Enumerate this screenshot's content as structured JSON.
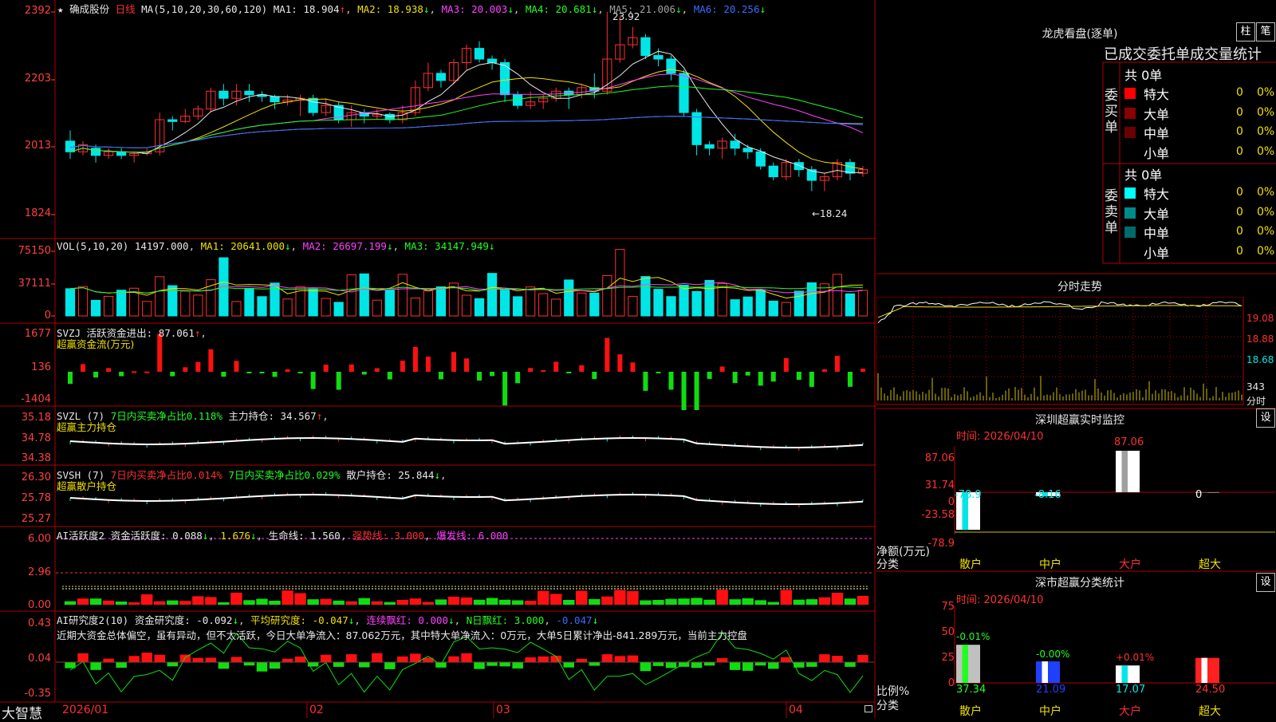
{
  "header": {
    "star": "★",
    "stock_name": "确成股份",
    "period": "日线",
    "ma_label": "MA(5,10,20,30,60,120)",
    "ma_values": [
      {
        "label": "MA1: 18.904",
        "arrow": "↑",
        "color": "#e8e8e8"
      },
      {
        "label": "MA2: 18.938",
        "arrow": "↓",
        "color": "#f0e000"
      },
      {
        "label": "MA3: 20.003",
        "arrow": "↓",
        "color": "#ff40ff"
      },
      {
        "label": "MA4: 20.681",
        "arrow": "↓",
        "color": "#20ff20"
      },
      {
        "label": "MA5: 21.006",
        "arrow": "↓",
        "color": "#a0a0a0"
      },
      {
        "label": "MA6: 20.256",
        "arrow": "↓",
        "color": "#3a6cff"
      }
    ]
  },
  "price_axis": [
    "2392",
    "2203",
    "2013",
    "1824"
  ],
  "price_marks": {
    "high": "23.92",
    "low": "←18.24"
  },
  "vol": {
    "title": "VOL(5,10,20)",
    "value": "14197.000",
    "ma1": "MA1: 20641.000",
    "ma2": "MA2: 26697.199",
    "ma3": "MA3: 34147.949",
    "arrow": "↓",
    "axis": [
      "75150",
      "37111",
      "0"
    ]
  },
  "svzj": {
    "title": "SVZJ",
    "label": "活跃资金进出: 87.061",
    "arrow": "↑",
    "sub": "超赢资金流(万元)",
    "axis": [
      "1677",
      "136",
      "-1404"
    ]
  },
  "svzl": {
    "title": "SVZL (7)",
    "label1": "7日内买卖净占比0.118%",
    "label2": "主力持仓: 34.567",
    "arrow": "↑",
    "sub": "超赢主力持仓",
    "axis": [
      "35.18",
      "34.78",
      "34.38"
    ]
  },
  "svsh": {
    "title": "SVSH (7)",
    "label1": "7日内买卖净占比0.014%",
    "label2": "7日内买卖净占比0.029%",
    "label3": "散户持仓: 25.844",
    "arrow": "↓",
    "sub": "超赢散户持仓",
    "axis": [
      "26.30",
      "25.78",
      "25.27"
    ]
  },
  "ai_active": {
    "title": "AI活跃度2",
    "label": "资金活跃度: 0.088",
    "v2": "1.676",
    "life": "生命线: 1.560",
    "strong": "强势线: 3.000",
    "burst": "爆发线: 6.000",
    "axis": [
      "6.00",
      "2.96",
      "0.00"
    ]
  },
  "ai_research": {
    "title": "AI研究度2(10)",
    "label": "资金研究度: -0.092",
    "avg": "平均研究度: -0.047",
    "cont": "连续飘红: 0.000",
    "nday": "N日飘红: 3.000",
    "nval": "-0.047",
    "comment": "近期大资金总体偏空，虽有异动，但不太活跃，今日大单净流入：87.062万元，其中特大单净流入：0万元，大单5日累计净出-841.289万元，当前主力控盘",
    "axis": [
      "0.43",
      "0.04",
      "-0.35"
    ]
  },
  "bottom": {
    "brand": "大智慧",
    "dates": [
      "2026/01",
      "02",
      "03",
      "04"
    ]
  },
  "right": {
    "dragon_title": "龙虎看盘(逐单)",
    "btn_zhu": "柱",
    "btn_bi": "笔",
    "table_header": "已成交委托单成交量统计",
    "buy_label": "委买单",
    "sell_label": "委卖单",
    "buy_total": "共 0单",
    "sell_total": "共 0单",
    "buy_rows": [
      {
        "name": "特大",
        "count": "0",
        "pct": "0%",
        "color": "#ff0000"
      },
      {
        "name": "大单",
        "count": "0",
        "pct": "0%",
        "color": "#8b0000"
      },
      {
        "name": "中单",
        "count": "0",
        "pct": "0%",
        "color": "#6b0000"
      },
      {
        "name": "小单",
        "count": "0",
        "pct": "0%",
        "color": ""
      }
    ],
    "sell_rows": [
      {
        "name": "特大",
        "count": "0",
        "pct": "0%",
        "color": "#00ffff"
      },
      {
        "name": "大单",
        "count": "0",
        "pct": "0%",
        "color": "#008b8b"
      },
      {
        "name": "中单",
        "count": "0",
        "pct": "0%",
        "color": "#006b6b"
      },
      {
        "name": "小单",
        "count": "0",
        "pct": "0%",
        "color": ""
      }
    ],
    "intraday_title": "分时走势",
    "intraday_axis": [
      "19.08",
      "18.88",
      "18.68",
      "343",
      "分时"
    ],
    "sz_monitor": {
      "title": "深圳超赢实时监控",
      "btn": "设",
      "time": "时间: 2026/04/10",
      "axis": [
        "87.06",
        "31.74",
        "0",
        "-23.58",
        "-78.9"
      ],
      "ylabel": "净额(万元)",
      "xlabel": "分类",
      "categories": [
        "散户",
        "中户",
        "大户",
        "超大"
      ],
      "values": [
        "-78.9",
        "-8.16",
        "87.06",
        "0"
      ]
    },
    "sz_class": {
      "title": "深市超赢分类统计",
      "btn": "设",
      "time": "时间: 2026/04/10",
      "axis": [
        "75",
        "50",
        "25",
        "0"
      ],
      "ylabel": "比例%",
      "xlabel": "分类",
      "categories": [
        "散户",
        "中户",
        "大户",
        "超大"
      ],
      "values": [
        "37.34",
        "21.09",
        "17.07",
        "24.50"
      ],
      "changes": [
        "-0.01%",
        "-0.00%",
        "+0.01%",
        ""
      ]
    }
  },
  "colors": {
    "up": "#ff3030",
    "down": "#00e6e6",
    "grid": "#b00000",
    "bg": "#000000"
  },
  "chart_data": [
    {
      "type": "candlestick",
      "title": "确成股份 日线",
      "ylim": [
        18.24,
        23.92
      ],
      "x": [
        "2026/01",
        "02",
        "03",
        "04"
      ],
      "candles": [
        [
          20.3,
          20.0,
          20.6,
          19.8
        ],
        [
          20.0,
          20.2,
          20.3,
          19.9
        ],
        [
          20.1,
          19.9,
          20.2,
          19.7
        ],
        [
          19.9,
          20.0,
          20.1,
          19.8
        ],
        [
          20.0,
          19.9,
          20.1,
          19.8
        ],
        [
          19.9,
          19.95,
          20.0,
          19.7
        ],
        [
          19.95,
          20.0,
          20.1,
          19.9
        ],
        [
          20.0,
          20.9,
          21.1,
          19.9
        ],
        [
          20.9,
          20.85,
          21.0,
          20.6
        ],
        [
          20.85,
          21.0,
          21.2,
          20.8
        ],
        [
          21.0,
          21.2,
          21.3,
          20.9
        ],
        [
          21.2,
          21.7,
          21.8,
          21.1
        ],
        [
          21.7,
          21.5,
          21.9,
          21.3
        ],
        [
          21.5,
          21.7,
          21.9,
          21.3
        ],
        [
          21.7,
          21.6,
          21.9,
          21.4
        ],
        [
          21.6,
          21.55,
          21.7,
          21.4
        ],
        [
          21.55,
          21.4,
          21.6,
          21.2
        ],
        [
          21.4,
          21.45,
          21.6,
          21.3
        ],
        [
          21.45,
          21.5,
          21.6,
          21.0
        ],
        [
          21.5,
          21.1,
          21.6,
          21.0
        ],
        [
          21.1,
          21.3,
          21.5,
          21.0
        ],
        [
          21.3,
          20.9,
          21.4,
          20.8
        ],
        [
          20.9,
          21.1,
          21.3,
          20.7
        ],
        [
          21.1,
          21.0,
          21.2,
          20.8
        ],
        [
          21.0,
          21.05,
          21.2,
          20.9
        ],
        [
          21.05,
          20.9,
          21.1,
          20.8
        ],
        [
          20.9,
          21.1,
          21.3,
          20.8
        ],
        [
          21.1,
          21.8,
          22.0,
          21.0
        ],
        [
          21.8,
          22.2,
          22.5,
          21.7
        ],
        [
          22.2,
          22.0,
          22.3,
          21.8
        ],
        [
          22.0,
          22.5,
          22.6,
          21.9
        ],
        [
          22.5,
          22.9,
          23.0,
          22.3
        ],
        [
          22.9,
          22.6,
          23.1,
          22.5
        ],
        [
          22.6,
          22.5,
          22.7,
          22.3
        ],
        [
          22.5,
          21.6,
          22.6,
          21.4
        ],
        [
          21.6,
          21.3,
          21.7,
          21.2
        ],
        [
          21.3,
          21.4,
          21.7,
          21.2
        ],
        [
          21.4,
          21.5,
          21.6,
          21.2
        ],
        [
          21.5,
          21.7,
          21.8,
          21.4
        ],
        [
          21.7,
          21.6,
          21.8,
          21.2
        ],
        [
          21.6,
          21.8,
          21.9,
          21.5
        ],
        [
          21.8,
          21.7,
          22.2,
          21.5
        ],
        [
          21.7,
          22.6,
          23.92,
          21.6
        ],
        [
          22.6,
          23.0,
          23.8,
          22.5
        ],
        [
          23.0,
          23.2,
          23.5,
          22.9
        ],
        [
          23.2,
          22.7,
          23.3,
          22.6
        ],
        [
          22.7,
          22.6,
          22.9,
          22.4
        ],
        [
          22.6,
          22.2,
          22.7,
          22.0
        ],
        [
          22.2,
          21.1,
          22.3,
          21.0
        ],
        [
          21.1,
          20.2,
          21.2,
          19.9
        ],
        [
          20.2,
          20.1,
          20.3,
          19.9
        ],
        [
          20.1,
          20.3,
          20.4,
          19.8
        ],
        [
          20.3,
          20.1,
          20.5,
          19.9
        ],
        [
          20.1,
          20.0,
          20.2,
          19.8
        ],
        [
          20.0,
          19.6,
          20.1,
          19.5
        ],
        [
          19.6,
          19.3,
          19.7,
          19.2
        ],
        [
          19.3,
          19.7,
          19.8,
          19.2
        ],
        [
          19.7,
          19.5,
          19.8,
          19.3
        ],
        [
          19.5,
          19.2,
          19.6,
          18.9
        ],
        [
          19.2,
          19.3,
          19.4,
          18.9
        ],
        [
          19.3,
          19.7,
          19.8,
          19.2
        ],
        [
          19.7,
          19.4,
          19.8,
          19.2
        ],
        [
          19.4,
          19.5,
          19.6,
          19.3
        ]
      ]
    }
  ]
}
